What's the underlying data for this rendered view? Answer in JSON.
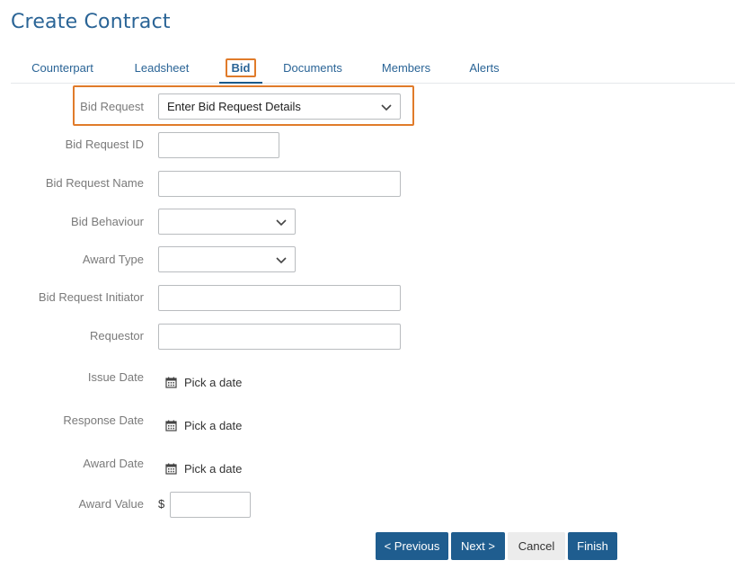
{
  "page": {
    "title": "Create Contract"
  },
  "tabs": [
    {
      "label": "Counterpart",
      "active": false
    },
    {
      "label": "Leadsheet",
      "active": false
    },
    {
      "label": "Bid",
      "active": true
    },
    {
      "label": "Documents",
      "active": false
    },
    {
      "label": "Members",
      "active": false
    },
    {
      "label": "Alerts",
      "active": false
    }
  ],
  "form": {
    "bid_request": {
      "label": "Bid Request",
      "value": "Enter Bid Request Details"
    },
    "bid_request_id": {
      "label": "Bid Request ID",
      "value": ""
    },
    "bid_request_name": {
      "label": "Bid Request Name",
      "value": ""
    },
    "bid_behaviour": {
      "label": "Bid Behaviour",
      "value": ""
    },
    "award_type": {
      "label": "Award Type",
      "value": ""
    },
    "bid_request_initiator": {
      "label": "Bid Request Initiator",
      "value": ""
    },
    "requestor": {
      "label": "Requestor",
      "value": ""
    },
    "issue_date": {
      "label": "Issue Date",
      "placeholder": "Pick a date"
    },
    "response_date": {
      "label": "Response Date",
      "placeholder": "Pick a date"
    },
    "award_date": {
      "label": "Award Date",
      "placeholder": "Pick a date"
    },
    "award_value": {
      "label": "Award Value",
      "currency": "$",
      "value": ""
    }
  },
  "buttons": {
    "previous": "< Previous",
    "next": "Next >",
    "cancel": "Cancel",
    "finish": "Finish"
  },
  "colors": {
    "accent": "#2a6496",
    "primary_button": "#1f5d8f",
    "highlight": "#e07b2a",
    "label_text": "#7a7a7a"
  },
  "icons": {
    "dropdown": "chevron-down-icon",
    "date": "calendar-icon"
  }
}
